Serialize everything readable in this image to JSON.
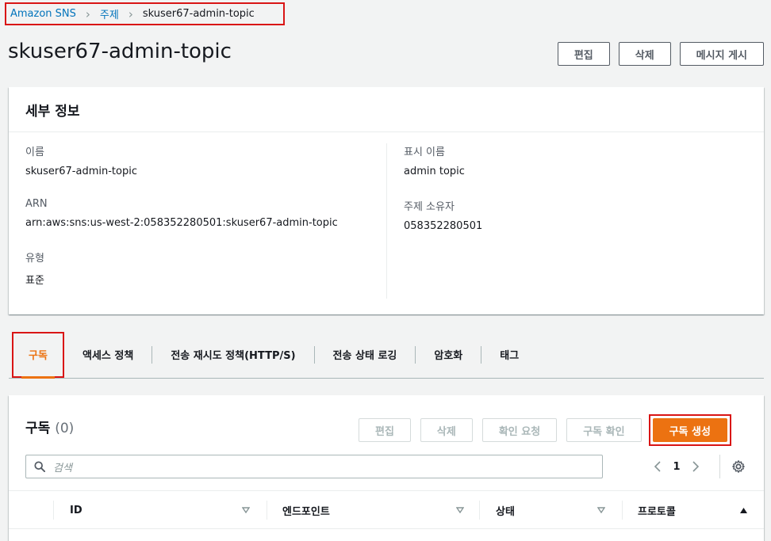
{
  "breadcrumb": {
    "items": [
      "Amazon SNS",
      "주제",
      "skuser67-admin-topic"
    ]
  },
  "page": {
    "title": "skuser67-admin-topic"
  },
  "header_actions": {
    "edit": "편집",
    "delete": "삭제",
    "publish": "메시지 게시"
  },
  "details": {
    "title": "세부 정보",
    "name_label": "이름",
    "name_value": "skuser67-admin-topic",
    "arn_label": "ARN",
    "arn_value": "arn:aws:sns:us-west-2:058352280501:skuser67-admin-topic",
    "type_label": "유형",
    "type_value": "표준",
    "display_name_label": "표시 이름",
    "display_name_value": "admin topic",
    "owner_label": "주제 소유자",
    "owner_value": "058352280501"
  },
  "tabs": [
    "구독",
    "액세스 정책",
    "전송 재시도 정책(HTTP/S)",
    "전송 상태 로깅",
    "암호화",
    "태그"
  ],
  "subscriptions": {
    "title": "구독",
    "count": "(0)",
    "edit": "편집",
    "delete": "삭제",
    "request_confirm": "확인 요청",
    "confirm": "구독 확인",
    "create": "구독 생성",
    "search_placeholder": "검색",
    "page": "1",
    "columns": [
      "ID",
      "엔드포인트",
      "상태",
      "프로토콜"
    ]
  },
  "colors": {
    "accent": "#ec7211",
    "link": "#0073bb",
    "highlight": "#d91515"
  }
}
